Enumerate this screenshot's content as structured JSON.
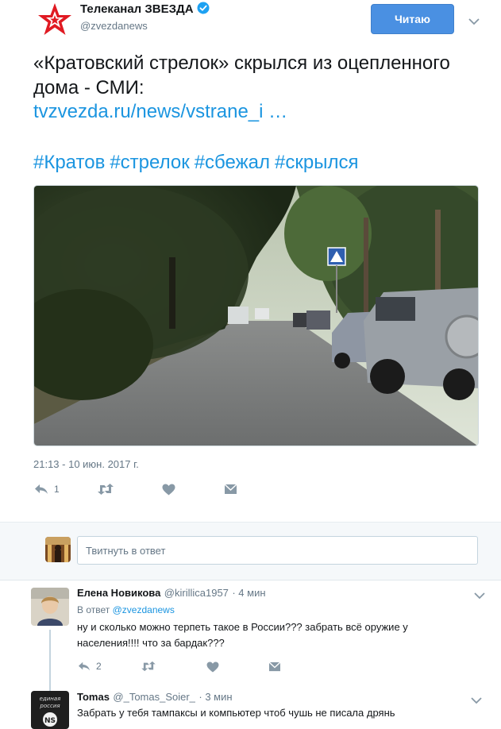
{
  "account": {
    "name": "Телеканал ЗВЕЗДА",
    "handle": "@zvezdanews",
    "verified": true,
    "follow_label": "Читаю"
  },
  "tweet": {
    "text": "«Кратовский стрелок» скрылся из оцепленного дома - СМИ:",
    "link": "tvzvezda.ru/news/vstrane_i …",
    "hashtags": [
      "#Кратов",
      "#стрелок",
      "#сбежал",
      "#скрылся"
    ],
    "timestamp": "21:13 - 10 июн. 2017 г.",
    "actions": {
      "reply_count": "1"
    }
  },
  "reply_input": {
    "placeholder": "Твитнуть в ответ"
  },
  "replies": [
    {
      "name": "Елена Новикова",
      "handle": "@kirillica1957",
      "time": "· 4 мин",
      "reply_to_prefix": "В ответ",
      "reply_to_handle": "@zvezdanews",
      "text": "ну и сколько можно терпеть такое в России???  забрать всё оружие у населения!!!!  что за бардак???",
      "reply_count": "2"
    },
    {
      "name": "Tomas",
      "handle": "@_Tomas_Soier_",
      "time": "· 3 мин",
      "text": "Забрать у тебя тампаксы и компьютер чтоб чушь не писала дрянь",
      "avatar_text": "Единая Россия"
    }
  ],
  "colors": {
    "accent": "#1b95e0",
    "follow_button": "#4a90e2",
    "brand_red": "#e01a22",
    "muted": "#657786",
    "like_icon": "#8899a6"
  },
  "icons": [
    "star-logo-icon",
    "verified-badge-icon",
    "chevron-down-icon",
    "reply-icon",
    "retweet-icon",
    "heart-icon",
    "dm-icon"
  ]
}
